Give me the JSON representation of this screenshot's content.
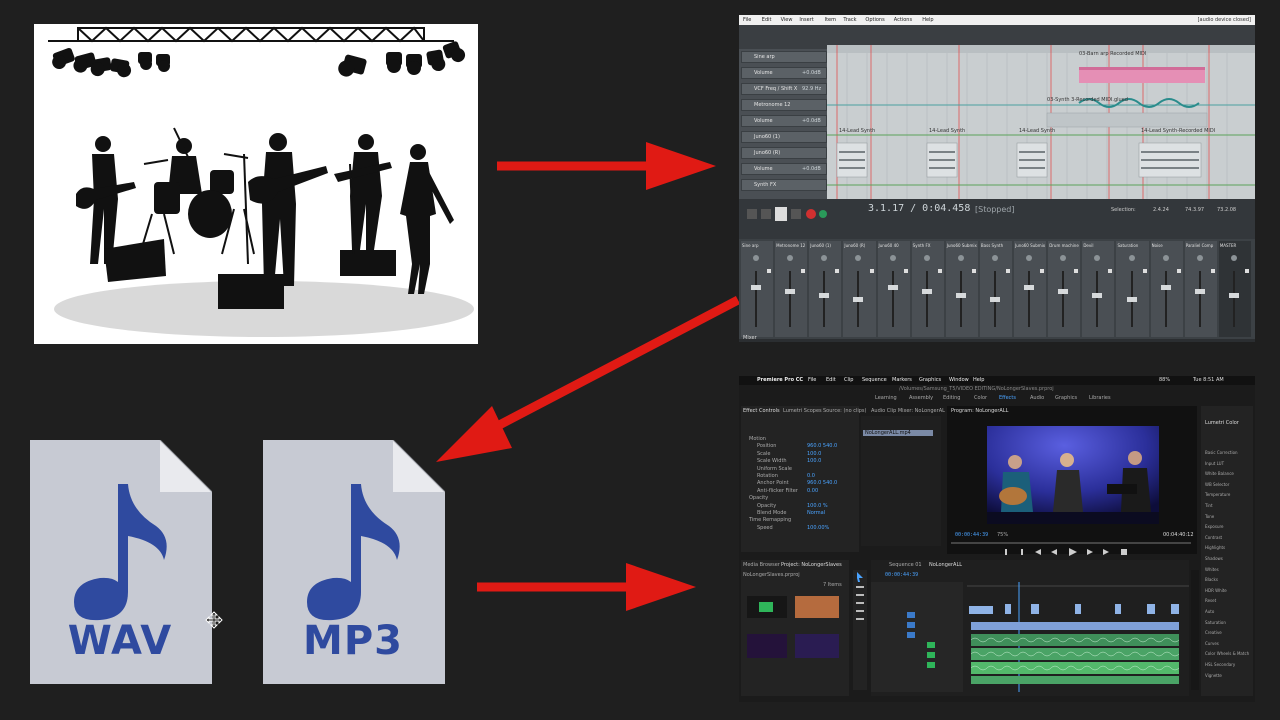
{
  "files": {
    "wav": {
      "label": "WAV"
    },
    "mp3": {
      "label": "MP3"
    }
  },
  "daw": {
    "menu": [
      "File",
      "Edit",
      "View",
      "Insert",
      "Item",
      "Track",
      "Options",
      "Actions",
      "Help"
    ],
    "window_status": "[audio device closed]",
    "transport_time": "3.1.17 / 0:04.458",
    "transport_state": "[Stopped]",
    "selection_label": "Selection:",
    "selection_values": [
      "2.4.24",
      "74.3.97",
      "73.2.08"
    ],
    "track_names": [
      "Sine arp",
      "Volume",
      "VCF Freq / Shift X",
      "Metronome 12",
      "Volume",
      "Juno60 (1)",
      "Juno60 (R)",
      "Volume",
      "Synth FX"
    ],
    "track_values": [
      "",
      "+0.0dB",
      "92.9 Hz",
      "",
      "+0.0dB",
      "",
      "",
      "+0.0dB",
      ""
    ],
    "item_labels": [
      "03-Barn arp Recorded MIDI",
      "03-Synth 3-Recorded MIDI.glued",
      "14-Lead Synth",
      "14-Lead Synth",
      "14-Lead Synth",
      "14-Lead Synth-Recorded MIDI"
    ],
    "mixer_strips": [
      "Sine arp",
      "Metronome 12",
      "Juno60 (1)",
      "Juno60 (R)",
      "Juno60 40",
      "Synth FX",
      "Juno60 Submix",
      "Bass Synth",
      "Juno60 Submix",
      "Drum machine",
      "Devil",
      "Saturation",
      "Noise",
      "Paraliel Comp",
      "MASTER"
    ],
    "mixer_tab": "Mixer"
  },
  "premiere": {
    "menu": [
      "Premiere Pro CC",
      "File",
      "Edit",
      "Clip",
      "Sequence",
      "Markers",
      "Graphics",
      "Window",
      "Help"
    ],
    "clock": "Tue 8:51 AM",
    "battery": "88%",
    "path": "/Volumes/Samsung_T5/VIDEO EDITING/NoLongerSlaves.prproj",
    "workspaces": [
      "Learning",
      "Assembly",
      "Editing",
      "Color",
      "Effects",
      "Audio",
      "Graphics",
      "Libraries"
    ],
    "effect_controls_tab": "Effect Controls",
    "lumetri_scopes_tab": "Lumetri Scopes",
    "source_tab": "Source: (no clips)",
    "audio_mixer_tab": "Audio Clip Mixer: NoLongerAL",
    "program_tab": "Program: NoLongerALL",
    "lumetri_color_tab": "Lumetri Color",
    "program_timecode": "00:00:44:39",
    "program_duration": "00:04:40:12",
    "fit_label": "75%",
    "timeline_timecode": "00:00:44:39",
    "sequence_tab": "Sequence 01",
    "nolonger_tab": "NoLongerALL",
    "media_browser_tab": "Media Browser",
    "project_tab": "Project: NoLongerSlaves",
    "project_file": "NoLongerSlaves.prproj",
    "items_count": "7 Items",
    "effects_props": [
      "Motion",
      "Position",
      "Scale",
      "Scale Width",
      "Uniform Scale",
      "Rotation",
      "Anchor Point",
      "Anti-flicker Filter",
      "Opacity",
      "Opacity",
      "Blend Mode",
      "Time Remapping",
      "Speed"
    ],
    "effects_values": [
      "",
      "960.0  540.0",
      "100.0",
      "100.0",
      "",
      "0.0",
      "960.0  540.0",
      "0.00",
      "",
      "100.0 %",
      "Normal",
      "",
      "100.00%"
    ],
    "lumetri_sections": [
      "Basic Correction",
      "Input LUT",
      "White Balance",
      "WB Selector",
      "Temperature",
      "Tint",
      "Tone",
      "Exposure",
      "Contrast",
      "Highlights",
      "Shadows",
      "Whites",
      "Blacks",
      "HDR White",
      "Reset",
      "Auto",
      "Saturation",
      "Creative",
      "Curves",
      "Color Wheels & Match",
      "HSL Secondary",
      "Vignette"
    ],
    "clip_label": "NoLongerALL.mp4"
  },
  "colors": {
    "background": "#1f1f1f",
    "arrow": "#e01a14",
    "file_body": "#c7cad3",
    "file_glyph": "#2f4a9f",
    "daw_bg": "#2b2e31",
    "daw_grid": "#c9ced0",
    "midi_pink": "#e58fb5",
    "premiere_bg": "#1b1b1b",
    "premiere_blue": "#4aa3ff",
    "audio_green": "#53b86b"
  },
  "icons": {
    "file_note": "music-note-icon",
    "arrow": "right-arrow-icon"
  }
}
